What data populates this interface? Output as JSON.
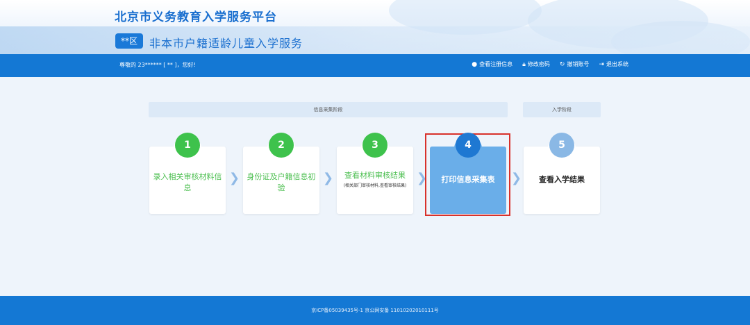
{
  "header": {
    "site_title": "北京市义务教育入学服务平台",
    "district_badge": "**区",
    "service_title": "非本市户籍适龄儿童入学服务"
  },
  "navbar": {
    "greeting": "尊敬的 23****** [ ** ]，您好!",
    "links": [
      {
        "icon": "info-icon",
        "label": "查看注册信息"
      },
      {
        "icon": "lock-icon",
        "label": "修改密码"
      },
      {
        "icon": "refresh-icon",
        "label": "撤销账号"
      },
      {
        "icon": "logout-icon",
        "label": "退出系统"
      }
    ]
  },
  "phases": {
    "collect": "信息采集阶段",
    "enroll": "入学阶段"
  },
  "steps": [
    {
      "num": "1",
      "label": "录入相关审核材料信息",
      "status": "done"
    },
    {
      "num": "2",
      "label": "身份证及户籍信息初验",
      "status": "done"
    },
    {
      "num": "3",
      "label": "查看材料审核结果",
      "sub": "(相关部门审核材料,查看审核结果)",
      "status": "done"
    },
    {
      "num": "4",
      "label": "打印信息采集表",
      "status": "current"
    },
    {
      "num": "5",
      "label": "查看入学结果",
      "status": "pending"
    }
  ],
  "footer": {
    "text": "京ICP备05039435号-1 京公网安备 11010202010111号"
  },
  "colors": {
    "primary": "#1478d4",
    "done": "#3ec24c",
    "current_card": "#6aaee9",
    "highlight": "#d8312b"
  }
}
